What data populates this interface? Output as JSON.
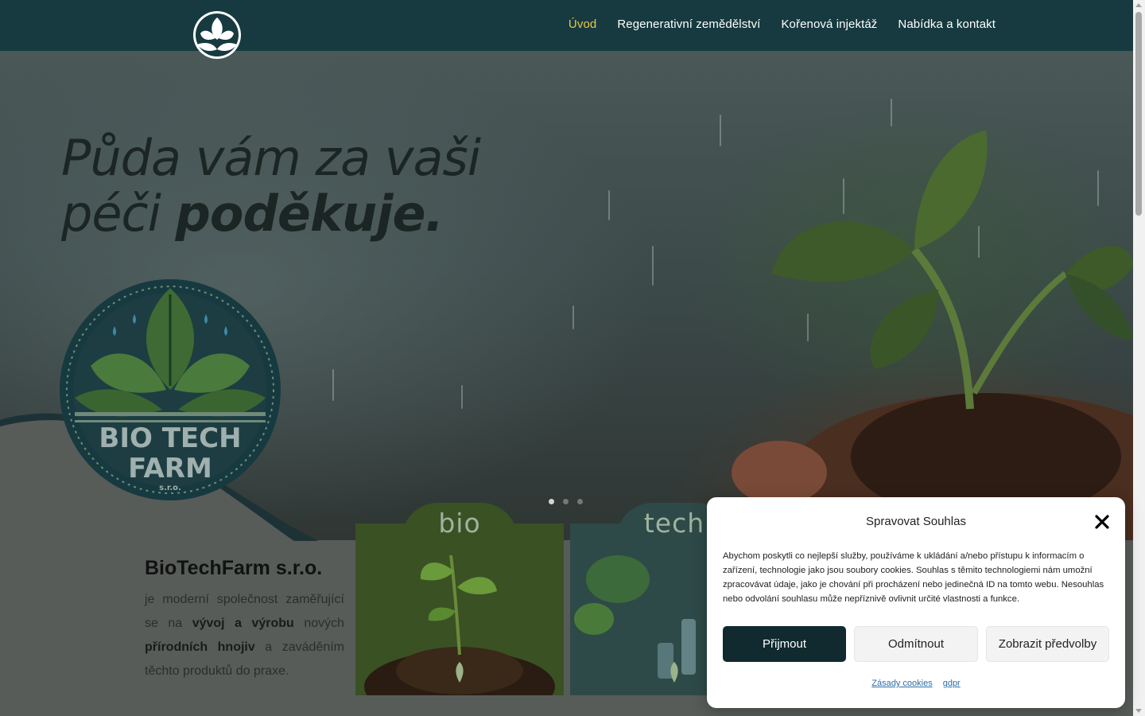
{
  "header": {
    "logo_alt": "BioTechFarm logo",
    "nav": [
      {
        "label": "Úvod",
        "active": true
      },
      {
        "label": "Regenerativní zemědělství",
        "active": false
      },
      {
        "label": "Kořenová injektáž",
        "active": false
      },
      {
        "label": "Nabídka a kontakt",
        "active": false
      }
    ]
  },
  "hero": {
    "title_line1": "Půda vám za vaši",
    "title_line2_regular": "péči ",
    "title_line2_bold": "poděkuje.",
    "slide_count": 3,
    "active_slide": 1
  },
  "logo_badge": {
    "line1": "BIO TECH",
    "line2": "FARM",
    "line3": "s.r.o."
  },
  "company": {
    "name": "BioTechFarm s.r.o.",
    "text_part1": "je moderní společnost zaměřující se na ",
    "text_bold1": "vývoj a výrobu",
    "text_part2": " nových ",
    "text_bold2": "přírodních hnojiv",
    "text_part3": " a zaváděním těchto produktů do praxe."
  },
  "cards": [
    {
      "label": "bio"
    },
    {
      "label": "tech"
    }
  ],
  "cookie": {
    "title": "Spravovat Souhlas",
    "text": "Abychom poskytli co nejlepší služby, používáme k ukládání a/nebo přístupu k informacím o zařízení, technologie jako jsou soubory cookies. Souhlas s těmito technologiemi nám umožní zpracovávat údaje, jako je chování při procházení nebo jedinečná ID na tomto webu. Nesouhlas nebo odvolání souhlasu může nepříznivě ovlivnit určité vlastnosti a funkce.",
    "accept_label": "Přijmout",
    "deny_label": "Odmítnout",
    "prefs_label": "Zobrazit předvolby",
    "links": [
      "Zásady cookies",
      "gdpr"
    ]
  },
  "colors": {
    "header_bg": "#163a3f",
    "nav_active": "#e8c94a",
    "accept_bg": "#102a2f",
    "link": "#2c6fa8"
  }
}
